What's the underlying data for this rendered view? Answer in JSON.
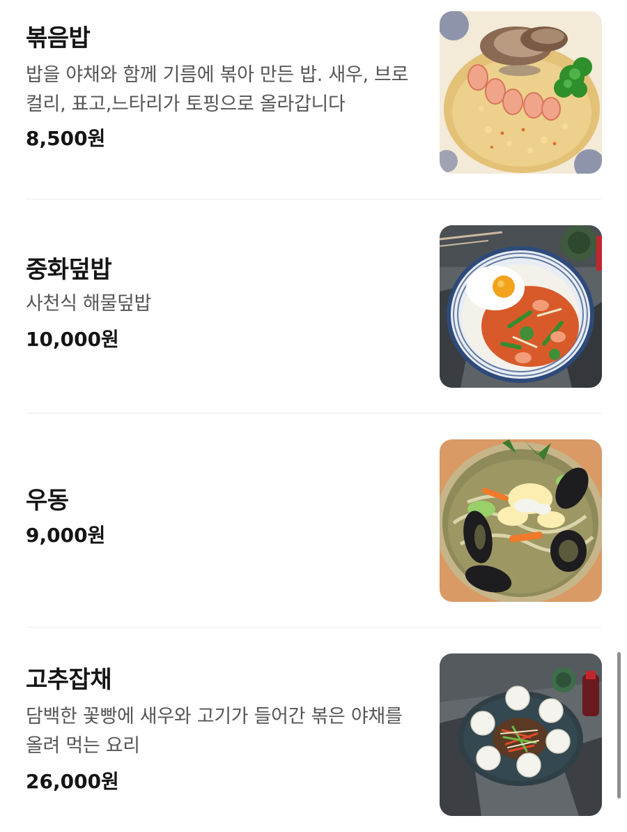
{
  "menu": {
    "items": [
      {
        "name": "볶음밥",
        "description": "밥을 야채와 함께 기름에 볶아 만든 밥. 새우, 브로컬리, 표고,느타리가 토핑으로 올라갑니다",
        "price": "8,500원",
        "image_icon": "fried-rice-photo"
      },
      {
        "name": "중화덮밥",
        "description": "사천식 해물덮밥",
        "price": "10,000원",
        "image_icon": "rice-bowl-photo"
      },
      {
        "name": "우동",
        "description": "",
        "price": "9,000원",
        "image_icon": "udon-photo"
      },
      {
        "name": "고추잡채",
        "description": "담백한 꽃빵에 새우와 고기가 들어간 볶은 야채를 올려 먹는 요리",
        "price": "26,000원",
        "image_icon": "japchae-photo"
      }
    ]
  },
  "colors": {
    "text_primary": "#141414",
    "text_secondary": "#555555",
    "divider": "#ececec",
    "scrollbar": "#8e8e8e"
  }
}
